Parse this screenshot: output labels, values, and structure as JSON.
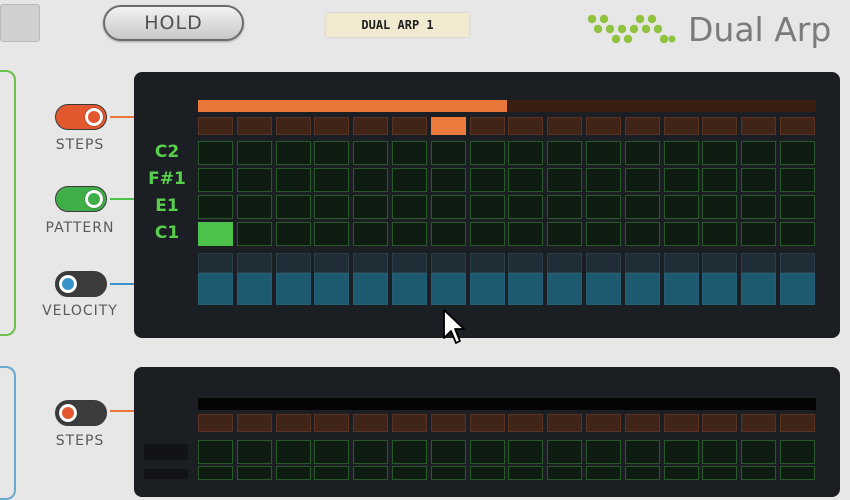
{
  "header": {
    "hold_label": "HOLD",
    "preset_name": "DUAL ARP 1",
    "brand_name": "Dual Arp"
  },
  "colors": {
    "orange": "#e7783a",
    "green": "#4cc24a",
    "blue": "#3a93c9",
    "panel": "#1b1e22",
    "background": "#e6e7e6"
  },
  "arp1": {
    "toggles": [
      {
        "label": "STEPS",
        "state": "on",
        "color": "orange"
      },
      {
        "label": "PATTERN",
        "state": "on",
        "color": "green"
      },
      {
        "label": "VELOCITY",
        "state": "off",
        "color": "blue"
      }
    ],
    "note_labels": [
      "C2",
      "F#1",
      "E1",
      "C1"
    ],
    "step_count": 16,
    "steps_enabled": 8,
    "current_step": 7,
    "pattern_on": [
      [
        0,
        0
      ]
    ],
    "velocity_fraction": 0.62
  },
  "arp2": {
    "toggles": [
      {
        "label": "STEPS",
        "state": "off",
        "color": "orange"
      }
    ],
    "step_count": 16
  }
}
